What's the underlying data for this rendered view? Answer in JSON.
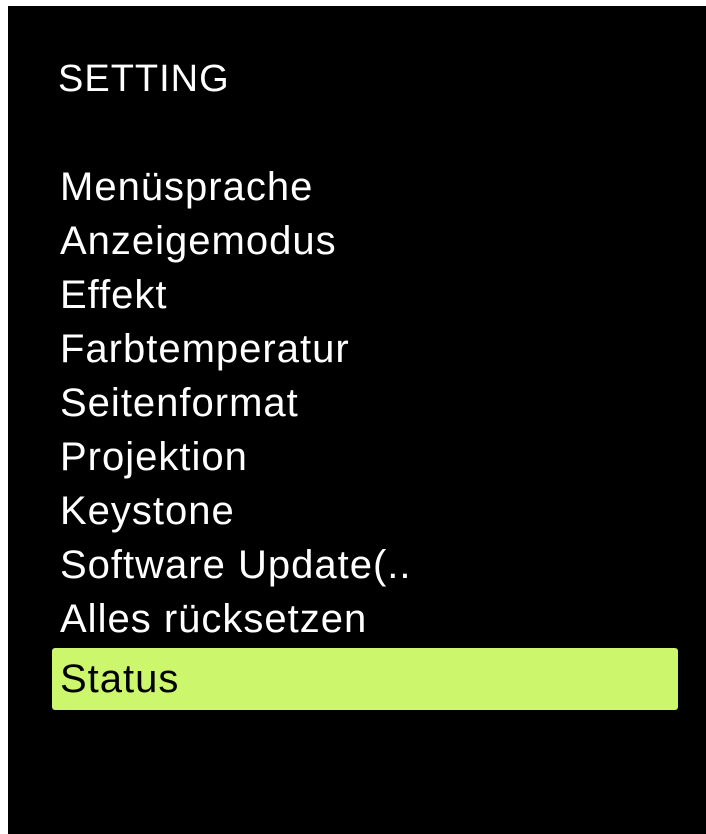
{
  "menu": {
    "title": "SETTING",
    "selected_index": 9,
    "highlight_color": "#ccf66b",
    "items": [
      {
        "label": "Menüsprache"
      },
      {
        "label": "Anzeigemodus"
      },
      {
        "label": "Effekt"
      },
      {
        "label": "Farbtemperatur"
      },
      {
        "label": "Seitenformat"
      },
      {
        "label": "Projektion"
      },
      {
        "label": "Keystone"
      },
      {
        "label": "Software Update(.."
      },
      {
        "label": "Alles rücksetzen"
      },
      {
        "label": "Status"
      }
    ]
  }
}
